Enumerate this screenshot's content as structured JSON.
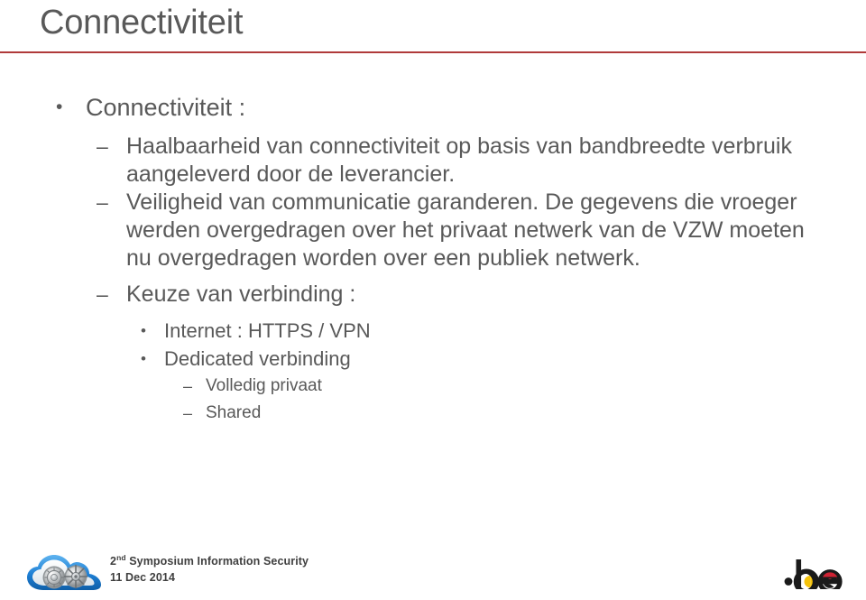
{
  "slide": {
    "title": "Connectiviteit",
    "rule_color": "#B03A3A",
    "text_color": "#595959"
  },
  "content": {
    "items": [
      {
        "level": 1,
        "marker": "•",
        "text": "Connectiviteit :"
      },
      {
        "level": 2,
        "marker": "–",
        "text": "Haalbaarheid van connectiviteit op basis van bandbreedte verbruik aangeleverd door de leverancier."
      },
      {
        "level": 2,
        "marker": "–",
        "text": "Veiligheid van communicatie garanderen. De gegevens die vroeger werden overgedragen over het privaat netwerk van de VZW moeten nu overgedragen worden over een publiek netwerk."
      },
      {
        "level": 2,
        "marker": "–",
        "text": "Keuze van verbinding :"
      },
      {
        "level": 3,
        "marker": "•",
        "text": "Internet : HTTPS / VPN"
      },
      {
        "level": 3,
        "marker": "•",
        "text": "Dedicated verbinding"
      },
      {
        "level": 4,
        "marker": "–",
        "text": "Volledig privaat"
      },
      {
        "level": 4,
        "marker": "–",
        "text": "Shared"
      }
    ]
  },
  "footer": {
    "logo_name": "cloud-security-logo",
    "event_prefix": "2",
    "event_ordinal": "nd",
    "event_name": " Symposium Information Security",
    "event_date": "11 Dec 2014",
    "brand_logo_name": "dot-be-logo",
    "brand_logo_text": ".be",
    "brand_yellow": "#F5C20A",
    "brand_red": "#CF2233",
    "brand_black": "#1A1A1A"
  }
}
